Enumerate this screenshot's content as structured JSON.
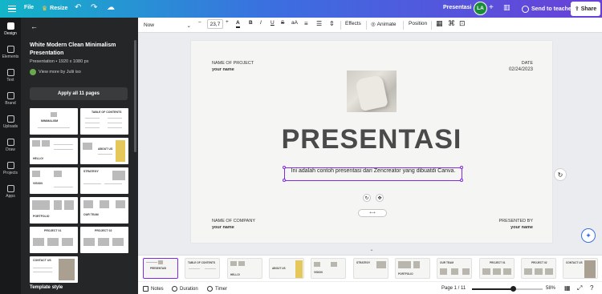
{
  "topbar": {
    "file": "File",
    "resize": "Resize",
    "title": "Presentasi",
    "avatar_initials": "LA",
    "send": "Send to teacher",
    "share": "Share"
  },
  "rail": {
    "items": [
      {
        "label": "Design"
      },
      {
        "label": "Elements"
      },
      {
        "label": "Text"
      },
      {
        "label": "Brand"
      },
      {
        "label": "Uploads"
      },
      {
        "label": "Draw"
      },
      {
        "label": "Projects"
      },
      {
        "label": "Apps"
      }
    ]
  },
  "panel": {
    "template_title": "White Modern Clean Minimalism Presentation",
    "template_size": "Presentation • 1920 x 1080 px",
    "view_more": "View more by Julii iso",
    "apply_all": "Apply all 11 pages",
    "section_label": "Template style",
    "thumbs": [
      {
        "title": "MINIMALISM"
      },
      {
        "title": "TABLE OF CONTENTS"
      },
      {
        "title": "HELLO!"
      },
      {
        "title": "ABOUT US"
      },
      {
        "title": "VISION"
      },
      {
        "title": "STRATEGY"
      },
      {
        "title": "PORTFOLIO"
      },
      {
        "title": "OUR TEAM"
      },
      {
        "title": "PROJECT 01"
      },
      {
        "title": "PROJECT 02"
      },
      {
        "title": "CONTACT US"
      }
    ]
  },
  "toolbar": {
    "font": "Now",
    "font_size": "23,7",
    "effects": "Effects",
    "animate": "Animate",
    "position": "Position"
  },
  "slide": {
    "project_label": "NAME OF PROJECT",
    "project_name": "your name",
    "date_label": "DATE",
    "date_value": "02/24/2023",
    "title": "PRESENTASI",
    "subtitle": "Ini adalah contoh presentasi dari Zencreator yang dibuatdi Canva.",
    "company_label": "NAME OF COMPANY",
    "company_name": "your name",
    "presented_label": "PRESENTED BY",
    "presented_name": "your name"
  },
  "filmstrip": {
    "pages": [
      {
        "label": "PRESENTASI"
      },
      {
        "label": "TABLE OF CONTENTS"
      },
      {
        "label": "HELLO!"
      },
      {
        "label": "ABOUT US"
      },
      {
        "label": "VISION"
      },
      {
        "label": "STRATEGY"
      },
      {
        "label": "PORTFOLIO"
      },
      {
        "label": "OUR TEAM"
      },
      {
        "label": "PROJECT 01"
      },
      {
        "label": "PROJECT 02"
      },
      {
        "label": "CONTACT US"
      }
    ]
  },
  "footer": {
    "notes": "Notes",
    "duration": "Duration",
    "timer": "Timer",
    "page": "Page 1 / 11",
    "zoom_level": 0.58,
    "zoom": "58%"
  },
  "colors": {
    "brand_purple": "#7d2ae8",
    "topbar_gradient_start": "#13b5c8",
    "topbar_gradient_end": "#6a3fd9",
    "panel_bg": "#252627"
  }
}
